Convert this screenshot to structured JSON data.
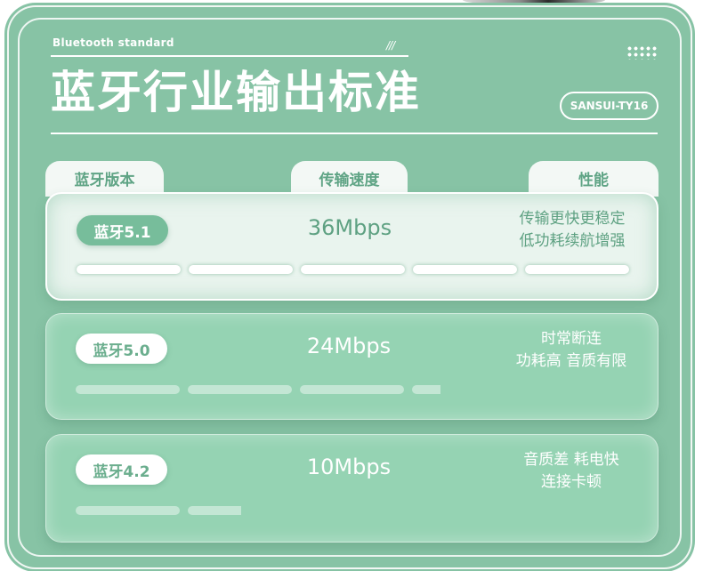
{
  "header": {
    "eyebrow": "Bluetooth standard",
    "slashes": "///",
    "title": "蓝牙行业输出标准",
    "model": "SANSUI-TY16"
  },
  "columns": {
    "version": "蓝牙版本",
    "speed": "传输速度",
    "performance": "性能"
  },
  "rows": [
    {
      "version": "蓝牙5.1",
      "speed": "36Mbps",
      "perf_line1": "传输更快更稳定",
      "perf_line2": "低功耗续航增强",
      "bar_level": 1.0
    },
    {
      "version": "蓝牙5.0",
      "speed": "24Mbps",
      "perf_line1": "时常断连",
      "perf_line2": "功耗高 音质有限",
      "bar_level": 0.66
    },
    {
      "version": "蓝牙4.2",
      "speed": "10Mbps",
      "perf_line1": "音质差 耗电快",
      "perf_line2": "连接卡顿",
      "bar_level": 0.3
    }
  ],
  "colors": {
    "background": "#87c3a5",
    "active_row": "#e9f4ee",
    "dim_row": "#95d3b3",
    "accent_text": "#5ea182"
  }
}
